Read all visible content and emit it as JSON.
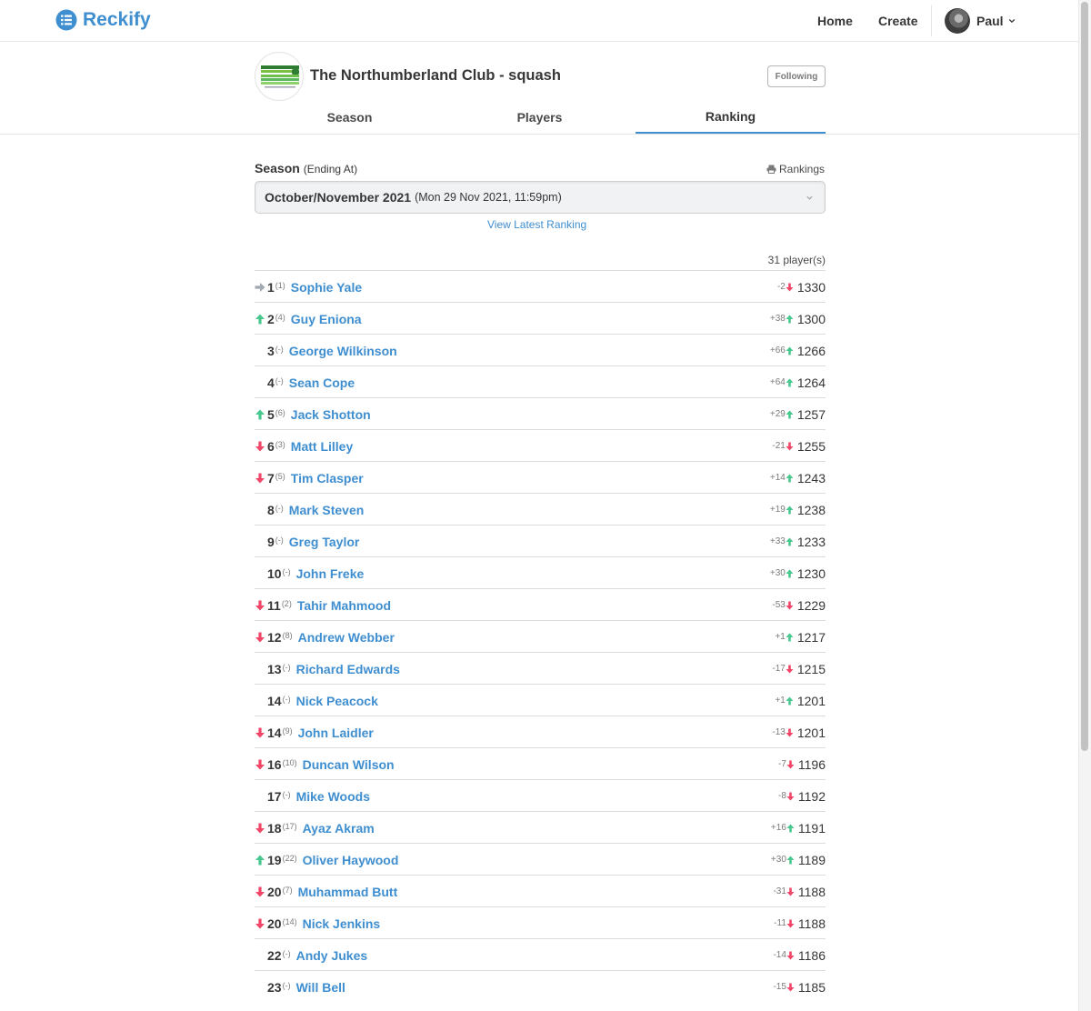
{
  "colors": {
    "accent": "#3e8ed0",
    "up": "#48c78e",
    "down": "#f14668",
    "same": "#a0a8b0"
  },
  "nav": {
    "brand": "Reckify",
    "brand_icon": "list-circle-icon",
    "links": [
      "Home",
      "Create"
    ],
    "user": "Paul"
  },
  "club": {
    "title": "The Northumberland Club - squash",
    "follow_label": "Following",
    "tabs": [
      {
        "label": "Season",
        "active": false
      },
      {
        "label": "Players",
        "active": false
      },
      {
        "label": "Ranking",
        "active": true
      }
    ]
  },
  "season": {
    "label": "Season",
    "label_note": "(Ending At)",
    "print_label": "Rankings",
    "selected": "October/November 2021",
    "selected_detail": "(Mon 29 Nov 2021, 11:59pm)",
    "view_latest": "View Latest Ranking"
  },
  "player_count": "31 player(s)",
  "rankings": [
    {
      "move": "same",
      "pos": "1",
      "prev": "(1)",
      "name": "Sophie Yale",
      "delta": "-2",
      "dir": "down",
      "rating": "1330"
    },
    {
      "move": "up",
      "pos": "2",
      "prev": "(4)",
      "name": "Guy Eniona",
      "delta": "+38",
      "dir": "up",
      "rating": "1300"
    },
    {
      "move": "none",
      "pos": "3",
      "prev": "(-)",
      "name": "George Wilkinson",
      "delta": "+66",
      "dir": "up",
      "rating": "1266"
    },
    {
      "move": "none",
      "pos": "4",
      "prev": "(-)",
      "name": "Sean Cope",
      "delta": "+64",
      "dir": "up",
      "rating": "1264"
    },
    {
      "move": "up",
      "pos": "5",
      "prev": "(6)",
      "name": "Jack Shotton",
      "delta": "+29",
      "dir": "up",
      "rating": "1257"
    },
    {
      "move": "down",
      "pos": "6",
      "prev": "(3)",
      "name": "Matt Lilley",
      "delta": "-21",
      "dir": "down",
      "rating": "1255"
    },
    {
      "move": "down",
      "pos": "7",
      "prev": "(5)",
      "name": "Tim Clasper",
      "delta": "+14",
      "dir": "up",
      "rating": "1243"
    },
    {
      "move": "none",
      "pos": "8",
      "prev": "(-)",
      "name": "Mark Steven",
      "delta": "+19",
      "dir": "up",
      "rating": "1238"
    },
    {
      "move": "none",
      "pos": "9",
      "prev": "(-)",
      "name": "Greg Taylor",
      "delta": "+33",
      "dir": "up",
      "rating": "1233"
    },
    {
      "move": "none",
      "pos": "10",
      "prev": "(-)",
      "name": "John Freke",
      "delta": "+30",
      "dir": "up",
      "rating": "1230"
    },
    {
      "move": "down",
      "pos": "11",
      "prev": "(2)",
      "name": "Tahir Mahmood",
      "delta": "-53",
      "dir": "down",
      "rating": "1229"
    },
    {
      "move": "down",
      "pos": "12",
      "prev": "(8)",
      "name": "Andrew Webber",
      "delta": "+1",
      "dir": "up",
      "rating": "1217"
    },
    {
      "move": "none",
      "pos": "13",
      "prev": "(-)",
      "name": "Richard Edwards",
      "delta": "-17",
      "dir": "down",
      "rating": "1215"
    },
    {
      "move": "none",
      "pos": "14",
      "prev": "(-)",
      "name": "Nick Peacock",
      "delta": "+1",
      "dir": "up",
      "rating": "1201"
    },
    {
      "move": "down",
      "pos": "14",
      "prev": "(9)",
      "name": "John Laidler",
      "delta": "-13",
      "dir": "down",
      "rating": "1201"
    },
    {
      "move": "down",
      "pos": "16",
      "prev": "(10)",
      "name": "Duncan Wilson",
      "delta": "-7",
      "dir": "down",
      "rating": "1196"
    },
    {
      "move": "none",
      "pos": "17",
      "prev": "(-)",
      "name": "Mike Woods",
      "delta": "-8",
      "dir": "down",
      "rating": "1192"
    },
    {
      "move": "down",
      "pos": "18",
      "prev": "(17)",
      "name": "Ayaz Akram",
      "delta": "+16",
      "dir": "up",
      "rating": "1191"
    },
    {
      "move": "up",
      "pos": "19",
      "prev": "(22)",
      "name": "Oliver Haywood",
      "delta": "+30",
      "dir": "up",
      "rating": "1189"
    },
    {
      "move": "down",
      "pos": "20",
      "prev": "(7)",
      "name": "Muhammad Butt",
      "delta": "-31",
      "dir": "down",
      "rating": "1188"
    },
    {
      "move": "down",
      "pos": "20",
      "prev": "(14)",
      "name": "Nick Jenkins",
      "delta": "-11",
      "dir": "down",
      "rating": "1188"
    },
    {
      "move": "none",
      "pos": "22",
      "prev": "(-)",
      "name": "Andy Jukes",
      "delta": "-14",
      "dir": "down",
      "rating": "1186"
    },
    {
      "move": "none",
      "pos": "23",
      "prev": "(-)",
      "name": "Will Bell",
      "delta": "-15",
      "dir": "down",
      "rating": "1185"
    }
  ]
}
